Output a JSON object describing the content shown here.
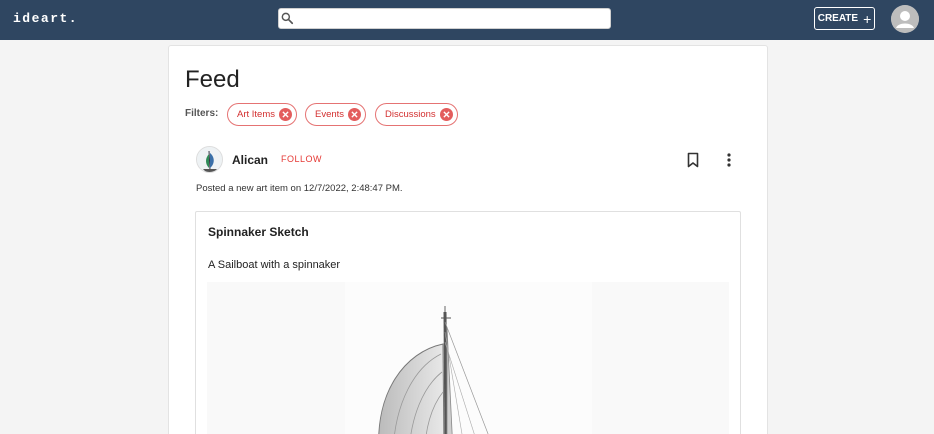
{
  "header": {
    "logo": "ideart.",
    "search_placeholder": "",
    "create_label": "CREATE",
    "create_icon": "plus-icon",
    "avatar_icon": "user-avatar-icon"
  },
  "feed": {
    "title": "Feed",
    "filters_label": "Filters:",
    "filters": [
      {
        "label": "Art Items"
      },
      {
        "label": "Events"
      },
      {
        "label": "Discussions"
      }
    ]
  },
  "post": {
    "username": "Alican",
    "follow_label": "FOLLOW",
    "posted_prefix": "Posted a new",
    "posted_type": "art item",
    "posted_on": "on 12/7/2022, 2:48:47 PM.",
    "item": {
      "title": "Spinnaker Sketch",
      "description": "A Sailboat with a spinnaker",
      "image_subject": "sailboat-sketch"
    }
  },
  "colors": {
    "topbar": "#2f4661",
    "accent": "#e53935",
    "chip_border": "#e57373"
  }
}
